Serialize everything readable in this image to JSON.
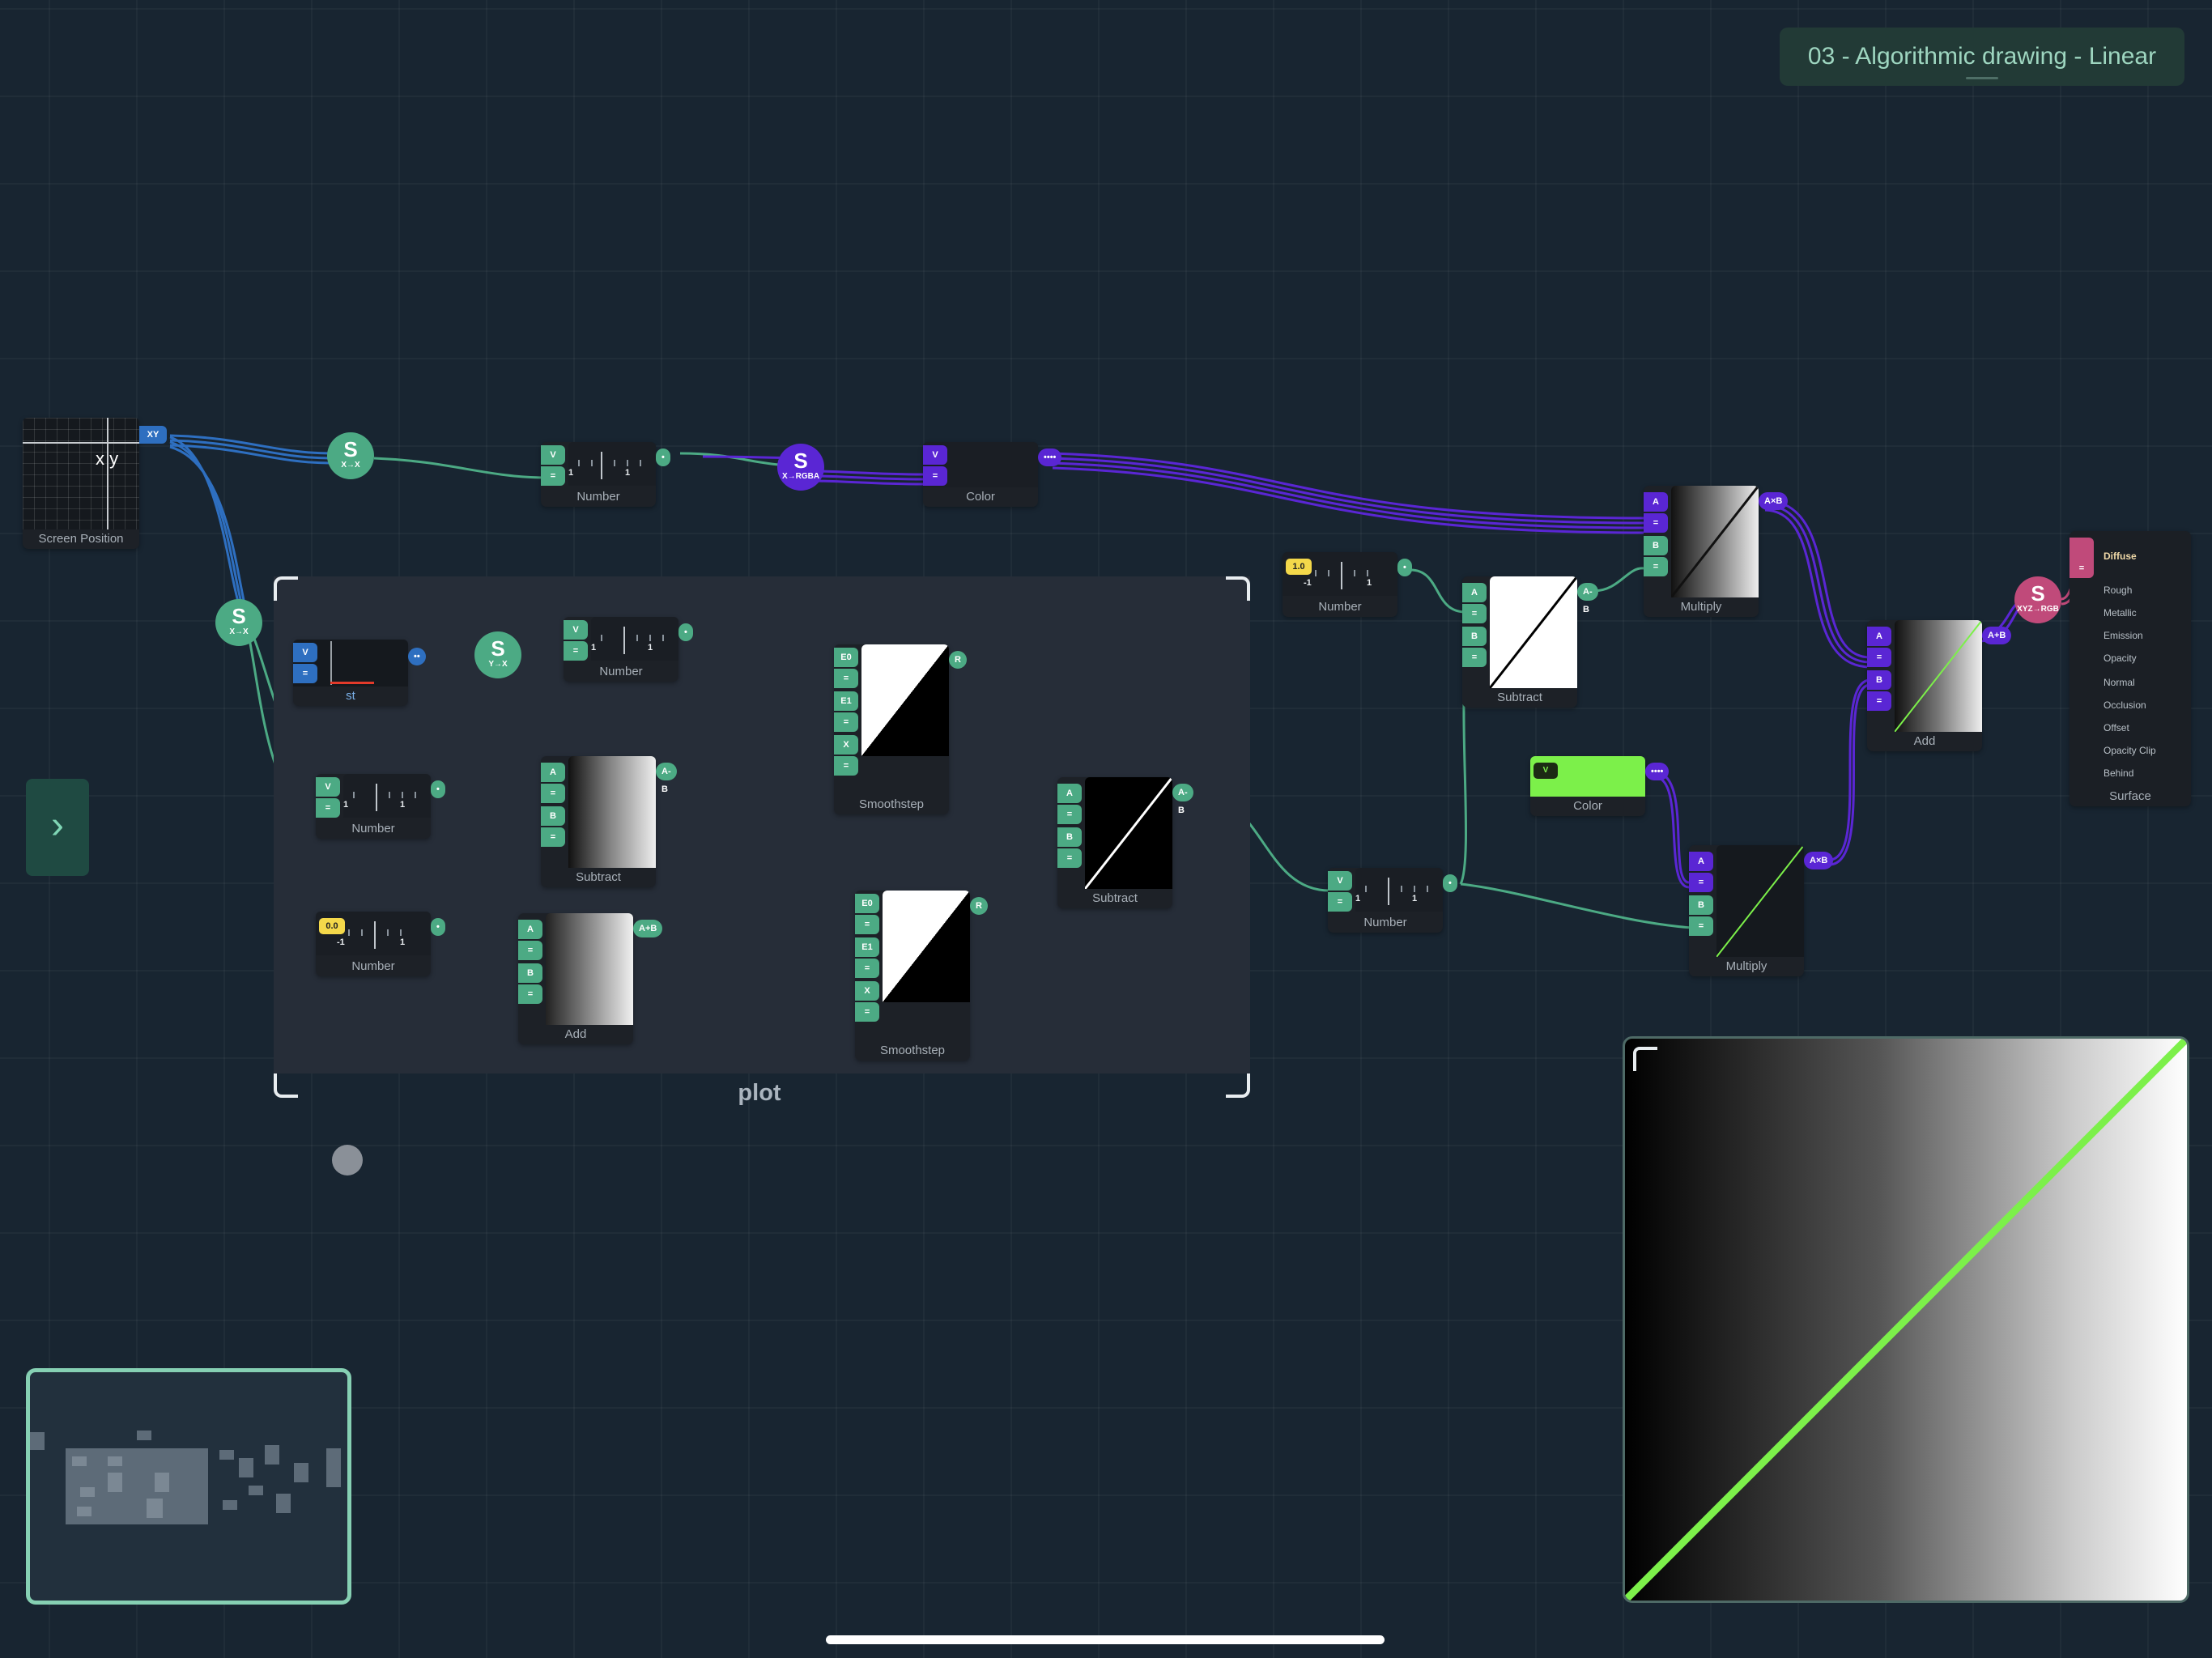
{
  "document": {
    "title": "03 - Algorithmic drawing - Linear"
  },
  "sidebar_toggle": {
    "glyph": "›"
  },
  "group": {
    "label": "plot"
  },
  "ports": {
    "eq": "=",
    "a": "A",
    "b": "B",
    "v": "V",
    "e0": "E0",
    "e1": "E1",
    "x": "X",
    "dot": "•",
    "dots2": "••",
    "dots4": "••••"
  },
  "nodes": {
    "screen_position": {
      "label": "Screen Position",
      "out": "XY",
      "preview_text": "x y"
    },
    "conv_xx_top": {
      "label": "X→X",
      "glyph": "S"
    },
    "conv_xx_left": {
      "label": "X→X",
      "glyph": "S"
    },
    "conv_yx": {
      "label": "Y→X",
      "glyph": "S"
    },
    "conv_xrgba": {
      "label": "X→RGBA",
      "glyph": "S"
    },
    "conv_xyzrgb": {
      "label": "XYZ→RGB",
      "glyph": "S"
    },
    "number_top": {
      "label": "Number",
      "tick_left": "1",
      "tick_right": "1"
    },
    "color_top": {
      "label": "Color"
    },
    "st": {
      "label": "st"
    },
    "number_plot": {
      "label": "Number",
      "tick_left": "1",
      "tick_right": "1"
    },
    "number_mid": {
      "label": "Number",
      "tick_left": "1",
      "tick_right": "1"
    },
    "number_zero": {
      "label": "Number",
      "value": "0.0",
      "tick_left": "-1",
      "tick_right": "1"
    },
    "subtract_plot": {
      "label": "Subtract",
      "out": "A-B"
    },
    "add_plot": {
      "label": "Add",
      "out": "A+B"
    },
    "smoothstep_top": {
      "label": "Smoothstep",
      "out": "R"
    },
    "smoothstep_bottom": {
      "label": "Smoothstep",
      "out": "R"
    },
    "subtract_mid": {
      "label": "Subtract",
      "out": "A-B"
    },
    "number_one": {
      "label": "Number",
      "value": "1.0",
      "tick_left": "-1",
      "tick_right": "1"
    },
    "subtract_right": {
      "label": "Subtract",
      "out": "A-B"
    },
    "number_right": {
      "label": "Number",
      "tick_left": "1",
      "tick_right": "1"
    },
    "multiply_top": {
      "label": "Multiply",
      "out": "A×B"
    },
    "color_green": {
      "label": "Color",
      "pin": "V",
      "swatch": "#7cf04a"
    },
    "multiply_bottom": {
      "label": "Multiply",
      "out": "A×B"
    },
    "add_right": {
      "label": "Add",
      "out": "A+B"
    },
    "surface": {
      "label": "Surface",
      "items": [
        "Diffuse",
        "Rough",
        "Metallic",
        "Emission",
        "Opacity",
        "Normal",
        "Occlusion",
        "Offset",
        "Opacity Clip",
        "Behind"
      ]
    }
  },
  "colors": {
    "background": "#182531",
    "float_wire": "#4caa84",
    "vector_wire": "#5a26d4",
    "coord_wire": "#2e6fc0",
    "line_green": "#7cf04a",
    "surface_pin": "#c04a7a"
  }
}
